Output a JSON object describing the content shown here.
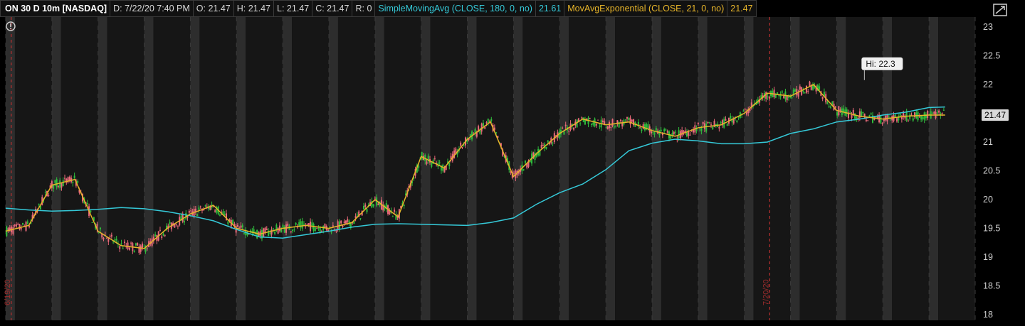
{
  "header": {
    "symbol": "ON 30 D 10m [NASDAQ]",
    "date": "D: 7/22/20 7:40 PM",
    "open": "O: 21.47",
    "high": "H: 21.47",
    "low": "L: 21.47",
    "close": "C: 21.47",
    "range": "R: 0",
    "sma_label": "SimpleMovingAvg (CLOSE, 180, 0, no)",
    "sma_value": "21.61",
    "ema_label": "MovAvgExponential (CLOSE, 21, 0, no)",
    "ema_value": "21.47"
  },
  "colors": {
    "background": "#000000",
    "session_dark": "#161616",
    "session_light": "#2d2d2d",
    "up_candle": "#2fbd3c",
    "down_candle": "#ea6a7a",
    "sma": "#35c9d8",
    "ema": "#e7b52a",
    "grid": "#3a3a3a"
  },
  "icons": {
    "info": "exclamation-circle-icon",
    "settings": "chart-settings-icon"
  },
  "chart_data": {
    "type": "line",
    "title": "ON 30 D 10m [NASDAQ]",
    "ylim": [
      17.9,
      23.1
    ],
    "y_ticks": [
      "23",
      "22.5",
      "22",
      "21.5",
      "21",
      "20.5",
      "20",
      "19.5",
      "19",
      "18.5",
      "18"
    ],
    "x_labels": [
      "6/19/20",
      "7/20/20"
    ],
    "sessions": 21,
    "high_label": "Hi: 22.3",
    "last_price_label": "21.47",
    "series": [
      {
        "name": "SimpleMovingAvg (CLOSE, 180, 0, no)",
        "x": [
          0,
          0.5,
          1,
          1.5,
          2,
          2.5,
          3,
          3.5,
          4,
          4.5,
          5,
          5.5,
          6,
          6.5,
          7,
          7.5,
          8,
          8.5,
          9,
          9.5,
          10,
          10.5,
          11,
          11.5,
          12,
          12.5,
          13,
          13.5,
          14,
          14.5,
          15,
          15.5,
          16,
          16.5,
          17,
          17.5,
          18,
          18.5,
          19,
          19.5,
          20,
          20.35
        ],
        "values": [
          19.85,
          19.82,
          19.8,
          19.81,
          19.83,
          19.86,
          19.84,
          19.79,
          19.72,
          19.63,
          19.48,
          19.35,
          19.33,
          19.39,
          19.45,
          19.52,
          19.57,
          19.58,
          19.57,
          19.56,
          19.55,
          19.6,
          19.68,
          19.92,
          20.12,
          20.27,
          20.52,
          20.85,
          20.98,
          21.05,
          21.02,
          20.97,
          20.97,
          21.0,
          21.15,
          21.23,
          21.35,
          21.4,
          21.47,
          21.52,
          21.6,
          21.61
        ]
      },
      {
        "name": "MovAvgExponential (CLOSE, 21, 0, no)",
        "x": [
          0,
          0.5,
          1,
          1.5,
          2,
          2.5,
          3,
          3.5,
          4,
          4.5,
          5,
          5.5,
          6,
          6.5,
          7,
          7.5,
          8,
          8.5,
          9,
          9.5,
          10,
          10.5,
          11,
          11.5,
          12,
          12.5,
          13,
          13.5,
          14,
          14.5,
          15,
          15.5,
          16,
          16.5,
          17,
          17.5,
          18,
          18.5,
          19,
          19.5,
          20,
          20.35
        ],
        "values": [
          19.45,
          19.55,
          20.25,
          20.35,
          19.45,
          19.2,
          19.15,
          19.5,
          19.75,
          19.9,
          19.5,
          19.4,
          19.5,
          19.55,
          19.5,
          19.6,
          20.0,
          19.7,
          20.75,
          20.55,
          21.05,
          21.35,
          20.4,
          20.8,
          21.15,
          21.4,
          21.3,
          21.35,
          21.2,
          21.1,
          21.25,
          21.3,
          21.5,
          21.85,
          21.8,
          22.0,
          21.55,
          21.45,
          21.4,
          21.45,
          21.47,
          21.47
        ]
      }
    ]
  }
}
